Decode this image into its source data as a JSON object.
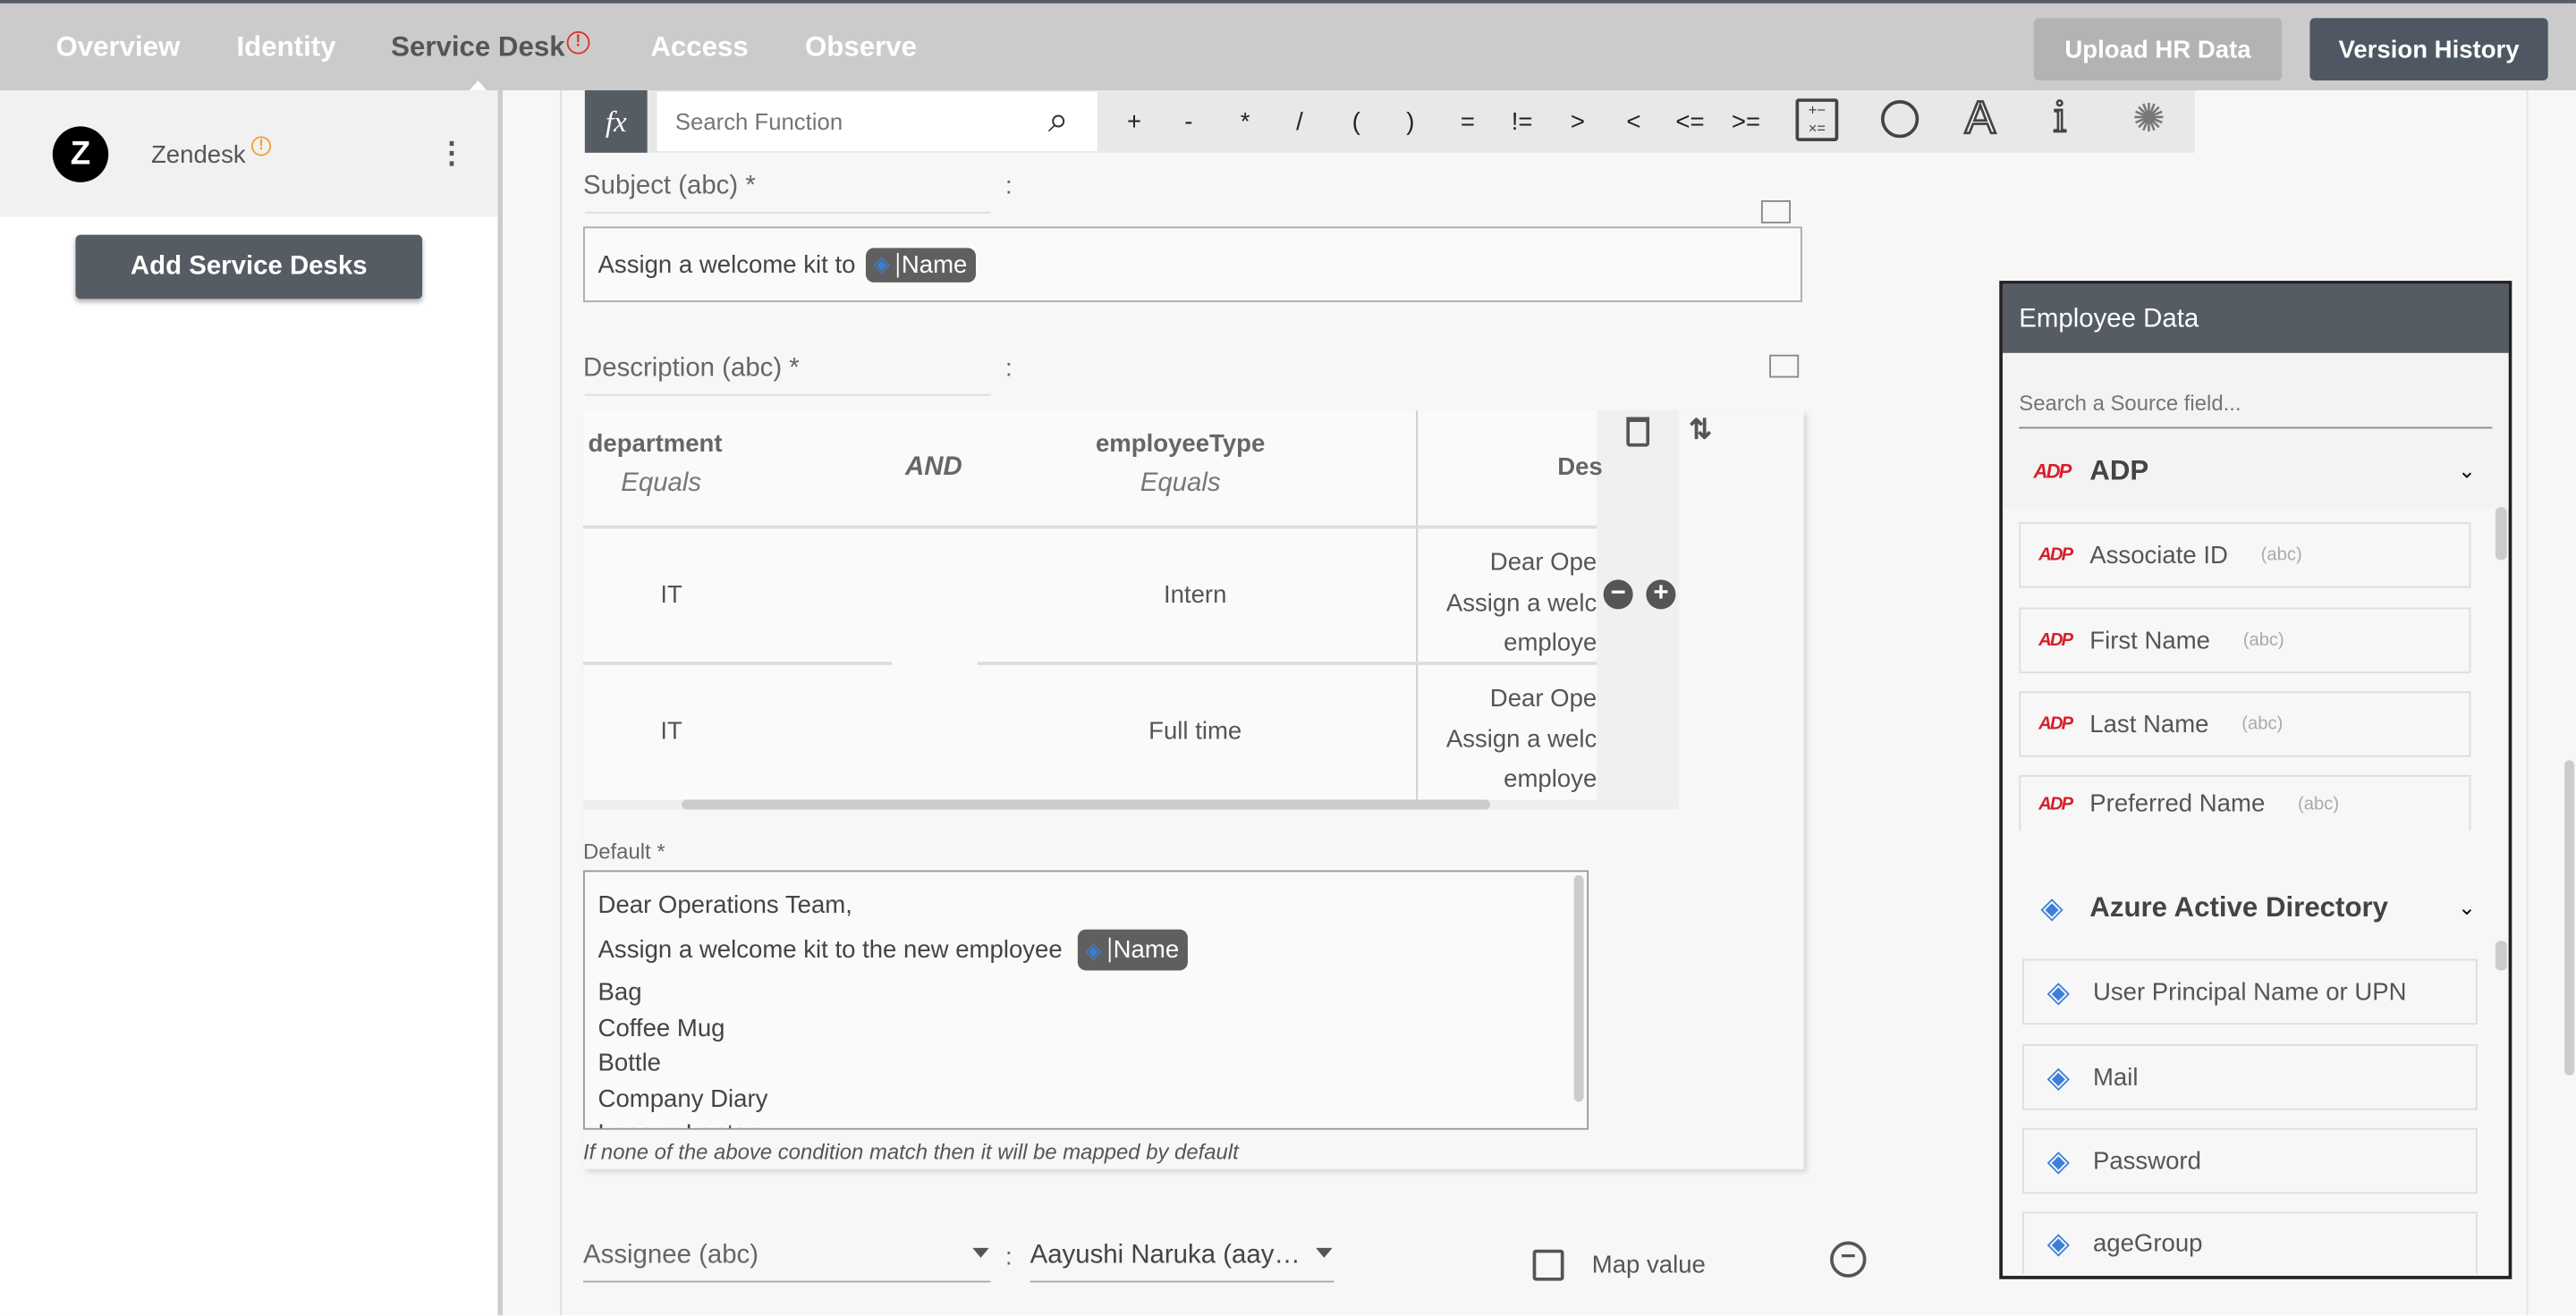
{
  "nav": {
    "tabs": [
      {
        "label": "Overview"
      },
      {
        "label": "Identity"
      },
      {
        "label": "Service Desk",
        "alert": "!"
      },
      {
        "label": "Access"
      },
      {
        "label": "Observe"
      }
    ],
    "upload_label": "Upload HR Data",
    "version_label": "Version History"
  },
  "sidebar": {
    "app_name": "Zendesk",
    "app_alert": "!",
    "add_label": "Add Service Desks"
  },
  "toolbar": {
    "fx": "fx",
    "search_placeholder": "Search Function",
    "operators": [
      "+",
      "-",
      "*",
      "/",
      "(",
      ")",
      "=",
      "!=",
      ">",
      "<",
      "<=",
      ">="
    ]
  },
  "subject": {
    "label": "Subject (abc) *",
    "colon": ":",
    "text": "Assign a welcome kit to",
    "chip": "Name"
  },
  "description": {
    "label": "Description (abc) *",
    "colon": ":",
    "headers": {
      "col1": "department",
      "col1_op": "Equals",
      "joiner": "AND",
      "col2": "employeeType",
      "col2_op": "Equals",
      "col3": "Des"
    },
    "rows": [
      {
        "c1": "IT",
        "c2": "Intern",
        "c3": [
          "Dear Ope",
          "Assign a welc",
          "employe"
        ]
      },
      {
        "c1": "IT",
        "c2": "Full time",
        "c3": [
          "Dear Ope",
          "Assign a welc",
          "employe"
        ]
      }
    ],
    "default_label": "Default *",
    "default_lines": [
      "Dear Operations Team,",
      "Assign a welcome kit to the new employee",
      "Bag",
      "Coffee Mug",
      "Bottle",
      "Company Diary",
      "Lenovo Laptop"
    ],
    "default_chip": "Name",
    "footnote": "If none of the above condition match then it will be mapped by default"
  },
  "assignee": {
    "label": "Assignee (abc)",
    "colon": ":",
    "value": "Aayushi Naruka (aay…",
    "map_label": "Map value",
    "map_checked": false
  },
  "employee_panel": {
    "title": "Employee Data",
    "search_placeholder": "Search a Source field...",
    "groups": [
      {
        "name": "ADP",
        "fields": [
          {
            "name": "Associate ID",
            "type": "(abc)"
          },
          {
            "name": "First Name",
            "type": "(abc)"
          },
          {
            "name": "Last Name",
            "type": "(abc)"
          },
          {
            "name": "Preferred Name",
            "type": "(abc)"
          }
        ]
      },
      {
        "name": "Azure Active Directory",
        "fields": [
          {
            "name": "User Principal Name or UPN"
          },
          {
            "name": "Mail"
          },
          {
            "name": "Password"
          },
          {
            "name": "ageGroup"
          }
        ]
      }
    ]
  },
  "colors": {
    "header_dark": "#555c64",
    "nav_bg": "#cbcbcb",
    "alert_red": "#e0352b",
    "warn_orange": "#f0a030",
    "adp_red": "#d3202b",
    "azure_blue": "#3b7fd9"
  }
}
